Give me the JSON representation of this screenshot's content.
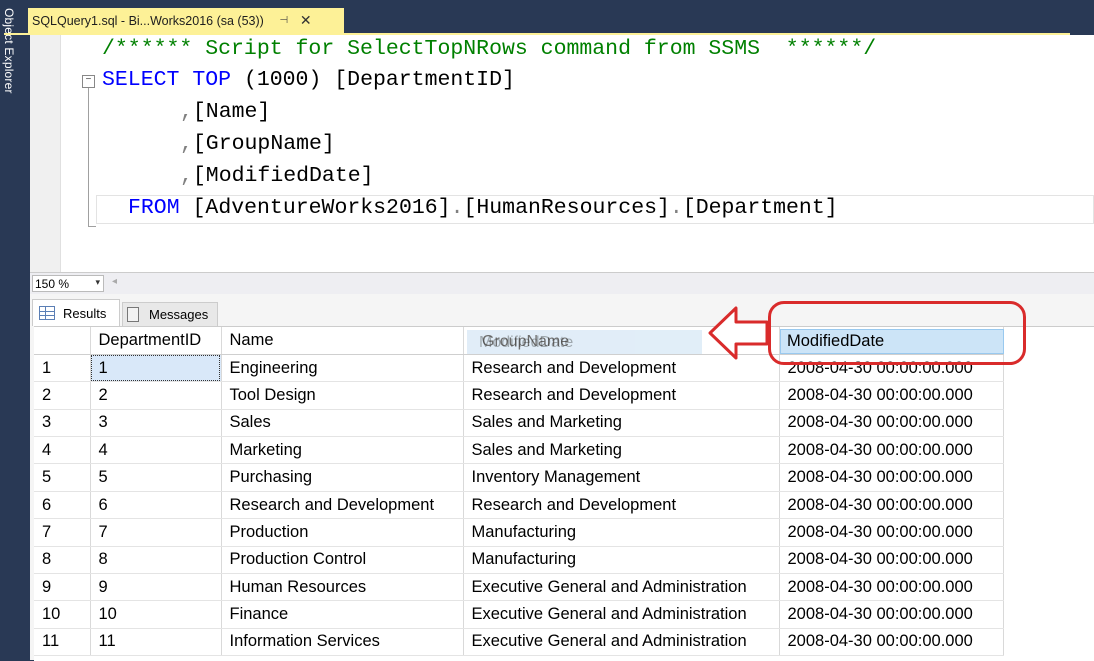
{
  "object_explorer": {
    "label": "Object Explorer"
  },
  "document_tab": {
    "title": "SQLQuery1.sql - Bi...Works2016 (sa (53))",
    "pin_glyph": "⊣",
    "close_glyph": "✕"
  },
  "editor": {
    "comment": "/****** Script for SelectTopNRows command from SSMS  ******/",
    "line_select_kw": "SELECT TOP ",
    "line_select_num": "(1000)",
    "line_select_col": " [DepartmentID]",
    "line2_comma": ",",
    "line2_col": "[Name]",
    "line3_comma": ",",
    "line3_col": "[GroupName]",
    "line4_comma": ",",
    "line4_col": "[ModifiedDate]",
    "line5_kw": "FROM ",
    "line5_db": "[AdventureWorks2016]",
    "line5_dot1": ".",
    "line5_schema": "[HumanResources]",
    "line5_dot2": ".",
    "line5_table": "[Department]",
    "collapse_glyph": "−"
  },
  "zoom": {
    "value": "150 %",
    "arrow": "▾",
    "scroll_left": "◂"
  },
  "tabs": {
    "results": "Results",
    "messages": "Messages"
  },
  "grid": {
    "columns": [
      "",
      "DepartmentID",
      "Name",
      "GroupName",
      "ModifiedDate"
    ],
    "rows": [
      [
        "1",
        "1",
        "Engineering",
        "Research and Development",
        "2008-04-30 00:00:00.000"
      ],
      [
        "2",
        "2",
        "Tool Design",
        "Research and Development",
        "2008-04-30 00:00:00.000"
      ],
      [
        "3",
        "3",
        "Sales",
        "Sales and Marketing",
        "2008-04-30 00:00:00.000"
      ],
      [
        "4",
        "4",
        "Marketing",
        "Sales and Marketing",
        "2008-04-30 00:00:00.000"
      ],
      [
        "5",
        "5",
        "Purchasing",
        "Inventory Management",
        "2008-04-30 00:00:00.000"
      ],
      [
        "6",
        "6",
        "Research and Development",
        "Research and Development",
        "2008-04-30 00:00:00.000"
      ],
      [
        "7",
        "7",
        "Production",
        "Manufacturing",
        "2008-04-30 00:00:00.000"
      ],
      [
        "8",
        "8",
        "Production Control",
        "Manufacturing",
        "2008-04-30 00:00:00.000"
      ],
      [
        "9",
        "9",
        "Human Resources",
        "Executive General and Administration",
        "2008-04-30 00:00:00.000"
      ],
      [
        "10",
        "10",
        "Finance",
        "Executive General and Administration",
        "2008-04-30 00:00:00.000"
      ],
      [
        "11",
        "11",
        "Information Services",
        "Executive General and Administration",
        "2008-04-30 00:00:00.000"
      ]
    ],
    "drag_ghost_label": "ModifiedDate",
    "drag_ghost_under": "GroupName",
    "dragged_header": "ModifiedDate"
  },
  "colors": {
    "tab_yellow": "#fdf197",
    "chrome_blue": "#293955",
    "annotation_red": "#d92b2b",
    "keyword_blue": "#0000ff",
    "comment_green": "#008000"
  }
}
